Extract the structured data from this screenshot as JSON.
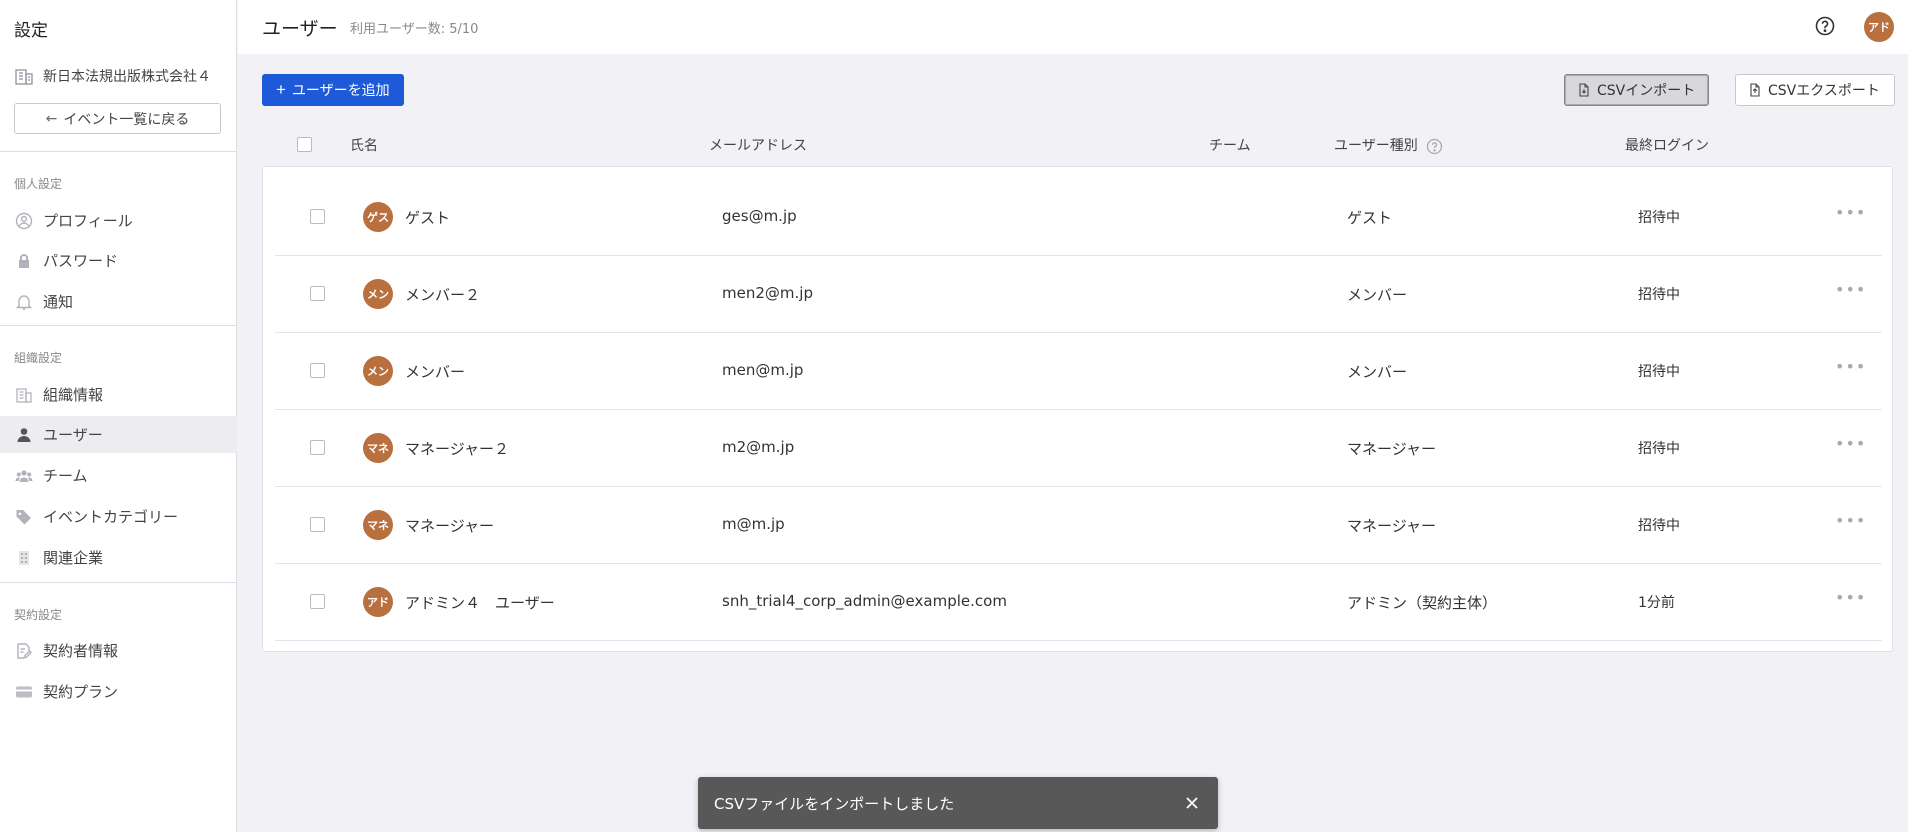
{
  "sidebar": {
    "title": "設定",
    "org_name": "新日本法規出版株式会社４",
    "back_label": "イベント一覧に戻る",
    "sections": {
      "personal": "個人設定",
      "organization": "組織設定",
      "contract": "契約設定"
    },
    "items": [
      {
        "label": "プロフィール",
        "icon": "profile-icon"
      },
      {
        "label": "パスワード",
        "icon": "lock-icon"
      },
      {
        "label": "通知",
        "icon": "bell-icon"
      },
      {
        "label": "組織情報",
        "icon": "building-icon"
      },
      {
        "label": "ユーザー",
        "icon": "user-icon",
        "active": true
      },
      {
        "label": "チーム",
        "icon": "team-icon"
      },
      {
        "label": "イベントカテゴリー",
        "icon": "tag-icon"
      },
      {
        "label": "関連企業",
        "icon": "company-icon"
      },
      {
        "label": "契約者情報",
        "icon": "contract-icon"
      },
      {
        "label": "契約プラン",
        "icon": "card-icon"
      }
    ]
  },
  "header": {
    "title": "ユーザー",
    "user_count": "利用ユーザー数: 5/10",
    "avatar_text": "アド"
  },
  "toolbar": {
    "add_label": "ユーザーを追加",
    "import_label": "CSVインポート",
    "export_label": "CSVエクスポート"
  },
  "table": {
    "columns": {
      "name": "氏名",
      "email": "メールアドレス",
      "team": "チーム",
      "role": "ユーザー種別",
      "last_login": "最終ログイン"
    },
    "rows": [
      {
        "avatar": "ゲス",
        "name": "ゲスト",
        "email": "ges@m.jp",
        "team": "",
        "role": "ゲスト",
        "last_login": "招待中"
      },
      {
        "avatar": "メン",
        "name": "メンバー２",
        "email": "men2@m.jp",
        "team": "",
        "role": "メンバー",
        "last_login": "招待中"
      },
      {
        "avatar": "メン",
        "name": "メンバー",
        "email": "men@m.jp",
        "team": "",
        "role": "メンバー",
        "last_login": "招待中"
      },
      {
        "avatar": "マネ",
        "name": "マネージャー２",
        "email": "m2@m.jp",
        "team": "",
        "role": "マネージャー",
        "last_login": "招待中"
      },
      {
        "avatar": "マネ",
        "name": "マネージャー",
        "email": "m@m.jp",
        "team": "",
        "role": "マネージャー",
        "last_login": "招待中"
      },
      {
        "avatar": "アド",
        "name": "アドミン４　ユーザー",
        "email": "snh_trial4_corp_admin@example.com",
        "team": "",
        "role": "アドミン（契約主体）",
        "last_login": "1分前"
      }
    ]
  },
  "toast": {
    "message": "CSVファイルをインポートしました"
  },
  "colors": {
    "primary": "#1e5ad7",
    "avatar": "#b8703f",
    "toast_bg": "#585858"
  }
}
